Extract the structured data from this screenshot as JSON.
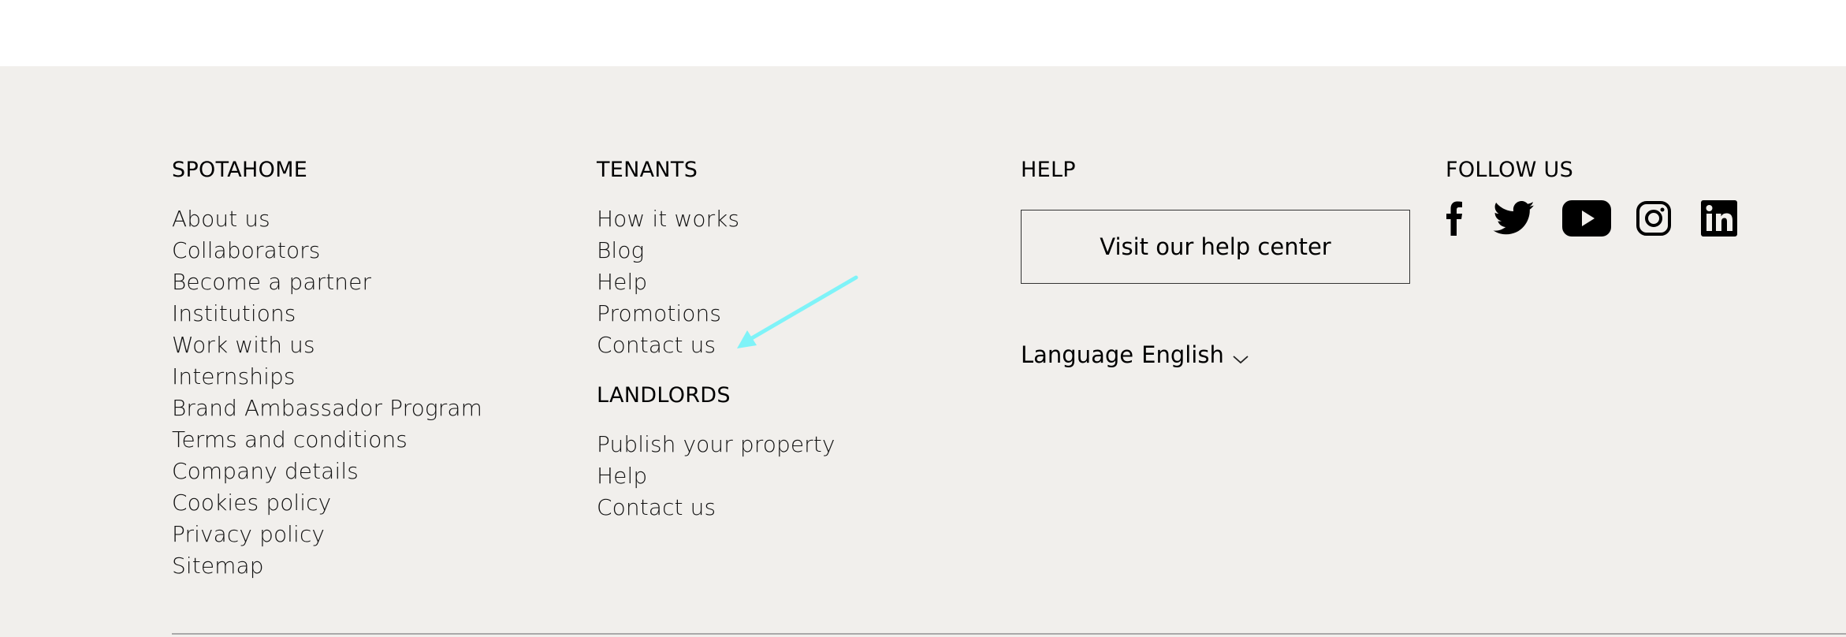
{
  "footer": {
    "spotahome": {
      "heading": "SPOTAHOME",
      "links": [
        "About us",
        "Collaborators",
        "Become a partner",
        "Institutions",
        "Work with us",
        "Internships",
        "Brand Ambassador Program",
        "Terms and conditions",
        "Company details",
        "Cookies policy",
        "Privacy policy",
        "Sitemap"
      ]
    },
    "tenants": {
      "heading": "TENANTS",
      "links": [
        "How it works",
        "Blog",
        "Help",
        "Promotions",
        "Contact us"
      ]
    },
    "landlords": {
      "heading": "LANDLORDS",
      "links": [
        "Publish your property",
        "Help",
        "Contact us"
      ]
    },
    "help": {
      "heading": "HELP",
      "button_label": "Visit our help center",
      "language_label": "Language",
      "language_value": "English"
    },
    "follow": {
      "heading": "FOLLOW US",
      "icons": [
        "facebook-icon",
        "twitter-icon",
        "youtube-icon",
        "instagram-icon",
        "linkedin-icon"
      ]
    }
  },
  "colors": {
    "footer_background": "#f1efec",
    "annotation_arrow": "#7ff3f8"
  }
}
